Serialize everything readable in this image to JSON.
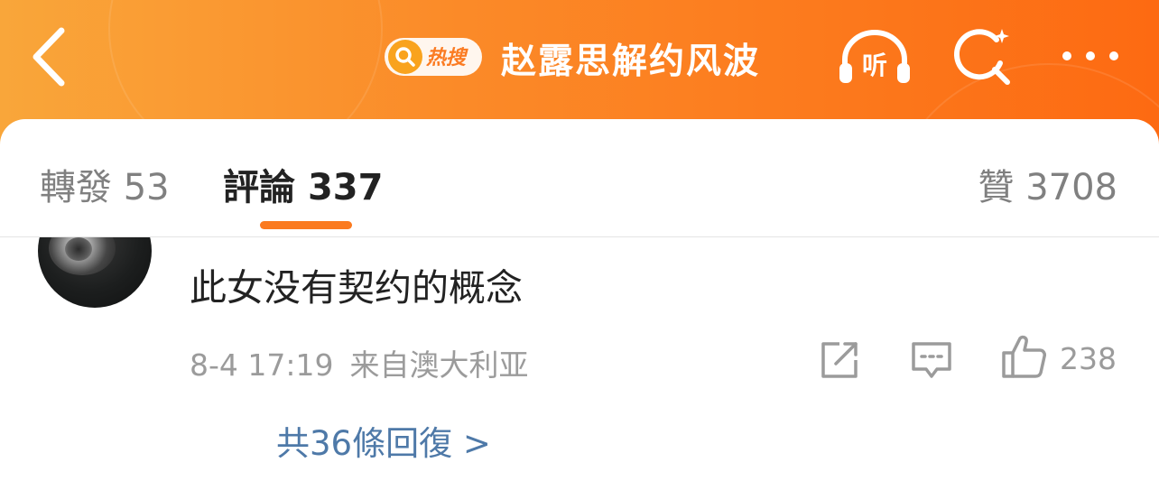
{
  "header": {
    "back_icon": "chevron-left-icon",
    "hot_badge_label": "热搜",
    "title": "赵露思解约风波",
    "listen_label": "听",
    "colors": {
      "gradient_start": "#f9a63a",
      "gradient_end": "#fd6a12"
    }
  },
  "tabs": [
    {
      "label": "轉發",
      "count": "53"
    },
    {
      "label": "評論",
      "count": "337",
      "active": true
    },
    {
      "label": "贊",
      "count": "3708"
    }
  ],
  "comment": {
    "text": "此女没有契约的概念",
    "time": "8-4 17:19",
    "location": "来自澳大利亚",
    "like_count": "238",
    "replies_label": "共36條回復 >"
  },
  "colors": {
    "accent": "#fb7a1f",
    "link": "#4e79a8"
  }
}
